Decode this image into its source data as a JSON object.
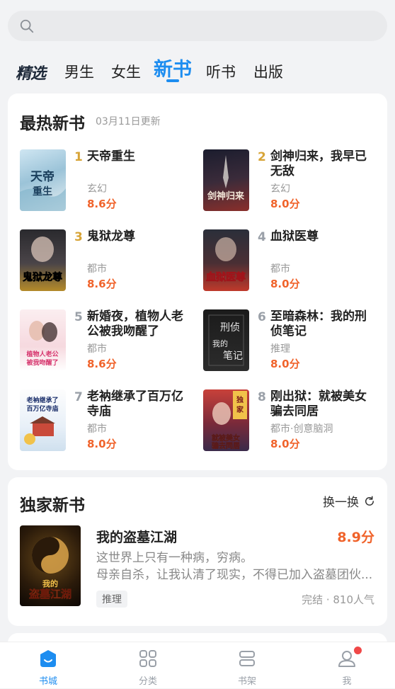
{
  "search": {
    "placeholder": ""
  },
  "tabs": [
    {
      "label": "精选"
    },
    {
      "label": "男生"
    },
    {
      "label": "女生"
    },
    {
      "label": "新书"
    },
    {
      "label": "听书"
    },
    {
      "label": "出版"
    }
  ],
  "active_tab": "新书",
  "hot_new": {
    "title": "最热新书",
    "updated": "03月11日更新",
    "books": [
      {
        "rank": "1",
        "title": "天帝重生",
        "category": "玄幻",
        "score": "8.6分",
        "cover_text": "天帝重生"
      },
      {
        "rank": "2",
        "title": "剑神归来，我早已无敌",
        "category": "玄幻",
        "score": "8.0分",
        "cover_text": "剑神归来"
      },
      {
        "rank": "3",
        "title": "鬼狱龙尊",
        "category": "都市",
        "score": "8.6分",
        "cover_text": "鬼狱龙尊"
      },
      {
        "rank": "4",
        "title": "血狱医尊",
        "category": "都市",
        "score": "8.0分",
        "cover_text": "血狱医尊"
      },
      {
        "rank": "5",
        "title": "新婚夜，植物人老公被我吻醒了",
        "category": "都市",
        "score": "8.6分",
        "cover_text": "植物人老公被我吻醒了"
      },
      {
        "rank": "6",
        "title": "至暗森林：我的刑侦笔记",
        "category": "推理",
        "score": "8.0分",
        "cover_text": "我的刑侦笔记"
      },
      {
        "rank": "7",
        "title": "老衲继承了百万亿寺庙",
        "category": "都市",
        "score": "8.0分",
        "cover_text": "老衲继承了百万亿寺庙"
      },
      {
        "rank": "8",
        "title": "刚出狱：就被美女骗去同居",
        "category": "都市·创意脑洞",
        "score": "8.0分",
        "cover_text": "就被美女骗去同居"
      }
    ]
  },
  "exclusive": {
    "title": "独家新书",
    "refresh_label": "换一换",
    "book": {
      "title": "我的盗墓江湖",
      "score": "8.9分",
      "desc_line1": "这世界上只有一种病，穷病。",
      "desc_line2": "母亲自杀，让我认清了现实，不得已加入盗墓团伙...",
      "tag": "推理",
      "meta": "完结 · 810人气",
      "cover_text": "我的盗墓江湖"
    }
  },
  "bottom_nav": [
    {
      "label": "书城",
      "icon": "bookstore-icon"
    },
    {
      "label": "分类",
      "icon": "grid-icon"
    },
    {
      "label": "书架",
      "icon": "bookshelf-icon"
    },
    {
      "label": "我",
      "icon": "user-icon"
    }
  ],
  "colors": {
    "accent": "#1d8df0",
    "score": "#f0632b",
    "rank_top": "#d7a437"
  }
}
